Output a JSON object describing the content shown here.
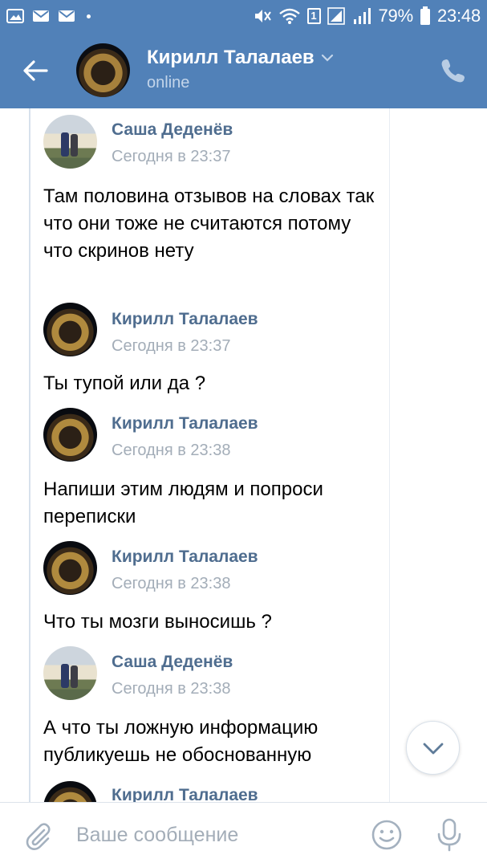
{
  "status_bar": {
    "battery": "79%",
    "time": "23:48",
    "sim": "1"
  },
  "header": {
    "contact_name": "Кирилл Талалаев",
    "status": "online"
  },
  "messages": [
    {
      "author": "Саша Деденёв",
      "time": "Сегодня в 23:37",
      "text": "Там половина отзывов на словах так что они тоже не считаются потому что скринов нету"
    },
    {
      "author": "Кирилл Талалаев",
      "time": "Сегодня в 23:37",
      "text": "Ты тупой или да ?"
    },
    {
      "author": "Кирилл Талалаев",
      "time": "Сегодня в 23:38",
      "text": "Напиши этим людям и попроси переписки"
    },
    {
      "author": "Кирилл Талалаев",
      "time": "Сегодня в 23:38",
      "text": "Что ты мозги выносишь ?"
    },
    {
      "author": "Саша Деденёв",
      "time": "Сегодня в 23:38",
      "text": "А что ты ложную информацию публикуешь не обоснованную"
    },
    {
      "author": "Кирилл Талалаев",
      "time": "",
      "text": ""
    }
  ],
  "composer": {
    "placeholder": "Ваше сообщение",
    "value": ""
  },
  "colors": {
    "header_bg": "#5181b8",
    "name_color": "#4f6d8f",
    "time_color": "#a3adb8"
  }
}
